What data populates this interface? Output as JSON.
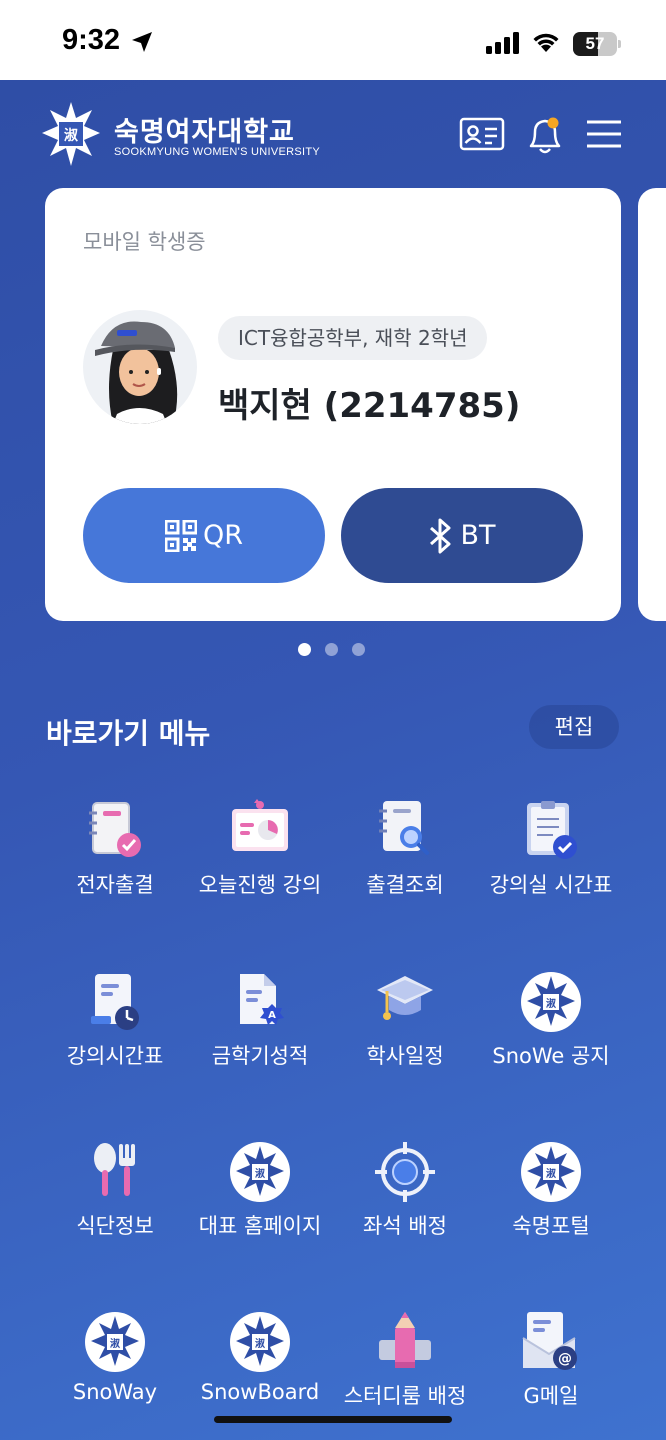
{
  "status_bar": {
    "time": "9:32",
    "battery_level": "57",
    "battery_fraction": 0.57
  },
  "header": {
    "logo_name": "숙명여자대학교",
    "logo_subtitle": "SOOKMYUNG WOMEN'S UNIVERSITY",
    "icons": [
      "id-card-icon",
      "bell-icon",
      "hamburger-menu-icon"
    ],
    "notification_dot_color": "#f5a623"
  },
  "student_card": {
    "title": "모바일 학생증",
    "department": "ICT융합공학부, 재학 2학년",
    "name": "백지현 (2214785)",
    "qr_label": "QR",
    "bt_label": "BT",
    "page_count": 3,
    "active_page": 1
  },
  "shortcuts": {
    "title": "바로가기 메뉴",
    "edit_label": "편집",
    "items": [
      {
        "label": "전자출결",
        "icon": "e-attendance-icon"
      },
      {
        "label": "오늘진행 강의",
        "icon": "today-lecture-icon"
      },
      {
        "label": "출결조회",
        "icon": "attendance-search-icon"
      },
      {
        "label": "강의실 시간표",
        "icon": "classroom-schedule-icon"
      },
      {
        "label": "강의시간표",
        "icon": "lecture-timetable-icon"
      },
      {
        "label": "금학기성적",
        "icon": "grade-icon"
      },
      {
        "label": "학사일정",
        "icon": "academic-calendar-icon"
      },
      {
        "label": "SnoWe 공지",
        "icon": "university-emblem-icon"
      },
      {
        "label": "식단정보",
        "icon": "meal-icon"
      },
      {
        "label": "대표 홈페이지",
        "icon": "university-emblem-icon"
      },
      {
        "label": "좌석 배정",
        "icon": "seat-target-icon"
      },
      {
        "label": "숙명포털",
        "icon": "university-emblem-icon"
      },
      {
        "label": "SnoWay",
        "icon": "university-emblem-icon"
      },
      {
        "label": "SnowBoard",
        "icon": "university-emblem-icon"
      },
      {
        "label": "스터디룸 배정",
        "icon": "study-room-icon"
      },
      {
        "label": "G메일",
        "icon": "gmail-icon"
      }
    ]
  },
  "colors": {
    "background": "#3557b4",
    "qr_button": "#4677d9",
    "bt_button": "#2f4b92",
    "accent_pink": "#e76bb0"
  }
}
